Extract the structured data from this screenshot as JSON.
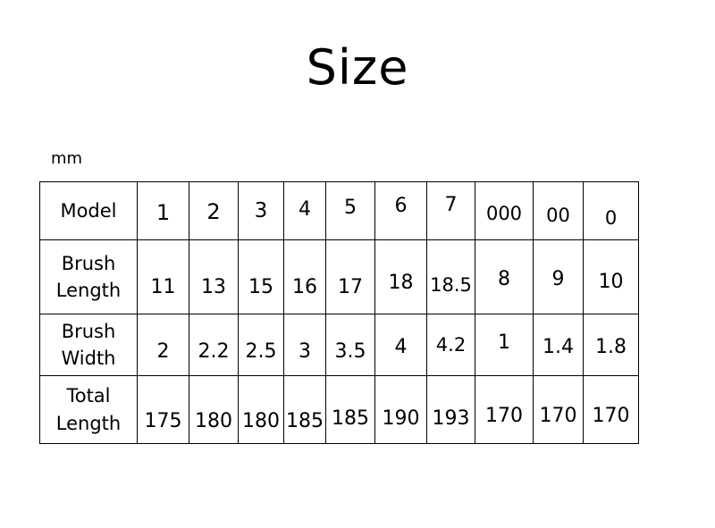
{
  "slide": {
    "title": "Size",
    "unit_label": "mm"
  },
  "table": {
    "row_labels": [
      {
        "line1": "Model",
        "line2": ""
      },
      {
        "line1": "Brush",
        "line2": "Length"
      },
      {
        "line1": "Brush",
        "line2": "Width"
      },
      {
        "line1": "Total",
        "line2": "Length"
      }
    ],
    "models": [
      "1",
      "2",
      "3",
      "4",
      "5",
      "6",
      "7",
      "000",
      "00",
      "0"
    ],
    "brush_length": [
      "11",
      "13",
      "15",
      "16",
      "17",
      "18",
      "18.5",
      "8",
      "9",
      "10"
    ],
    "brush_width": [
      "2",
      "2.2",
      "2.5",
      "3",
      "3.5",
      "4",
      "4.2",
      "1",
      "1.4",
      "1.8"
    ],
    "total_length": [
      "175",
      "180",
      "180",
      "185",
      "185",
      "190",
      "193",
      "170",
      "170",
      "170"
    ]
  },
  "chart_data": {
    "type": "table",
    "title": "Size",
    "unit": "mm",
    "columns": [
      "Model",
      "1",
      "2",
      "3",
      "4",
      "5",
      "6",
      "7",
      "000",
      "00",
      "0"
    ],
    "rows": [
      {
        "label": "Brush Length",
        "values": [
          11,
          13,
          15,
          16,
          17,
          18,
          18.5,
          8,
          9,
          10
        ]
      },
      {
        "label": "Brush Width",
        "values": [
          2,
          2.2,
          2.5,
          3,
          3.5,
          4,
          4.2,
          1,
          1.4,
          1.8
        ]
      },
      {
        "label": "Total Length",
        "values": [
          175,
          180,
          180,
          185,
          185,
          190,
          193,
          170,
          170,
          170
        ]
      }
    ]
  }
}
